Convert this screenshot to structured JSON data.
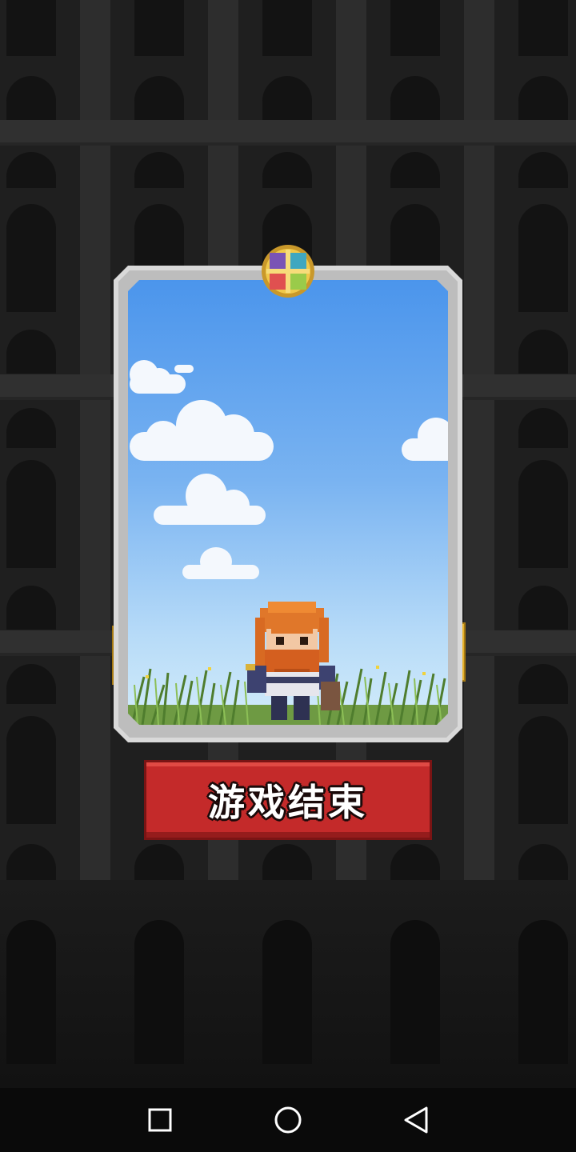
{
  "game_over": {
    "label": "游戏结束"
  },
  "card": {
    "scene": "sky-with-clouds-and-grass",
    "character": "red-bearded-knight"
  },
  "nav": {
    "recent": "square-icon",
    "home": "circle-icon",
    "back": "triangle-back-icon"
  },
  "colors": {
    "button_red": "#c42a2a",
    "sky_top": "#4b95ec",
    "sky_bottom": "#d2ecfa",
    "frame": "#d9d9d9",
    "gold": "#e6b32e"
  }
}
